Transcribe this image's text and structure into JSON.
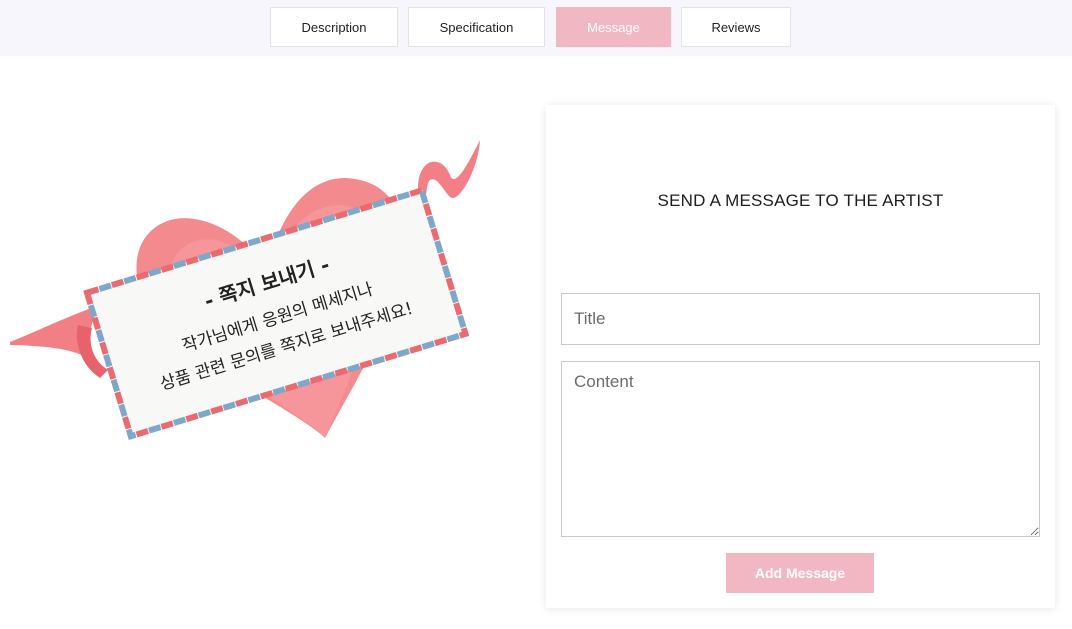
{
  "tabs": [
    {
      "label": "Description"
    },
    {
      "label": "Specification"
    },
    {
      "label": "Message"
    },
    {
      "label": "Reviews"
    }
  ],
  "active_tab": "Message",
  "illustration": {
    "line1": "- 쪽지 보내기 -",
    "line2": "작가님에게 응원의 메세지나",
    "line3": "상품 관련 문의를 쪽지로 보내주세요!"
  },
  "message_form": {
    "heading": "SEND A MESSAGE TO THE ARTIST",
    "title_placeholder": "Title",
    "content_placeholder": "Content",
    "submit_label": "Add Message"
  },
  "colors": {
    "accent": "#f1b8c4",
    "heart": "#f27d82",
    "ribbon": "#f37f86",
    "tabbar_bg": "#f7f6fc"
  }
}
